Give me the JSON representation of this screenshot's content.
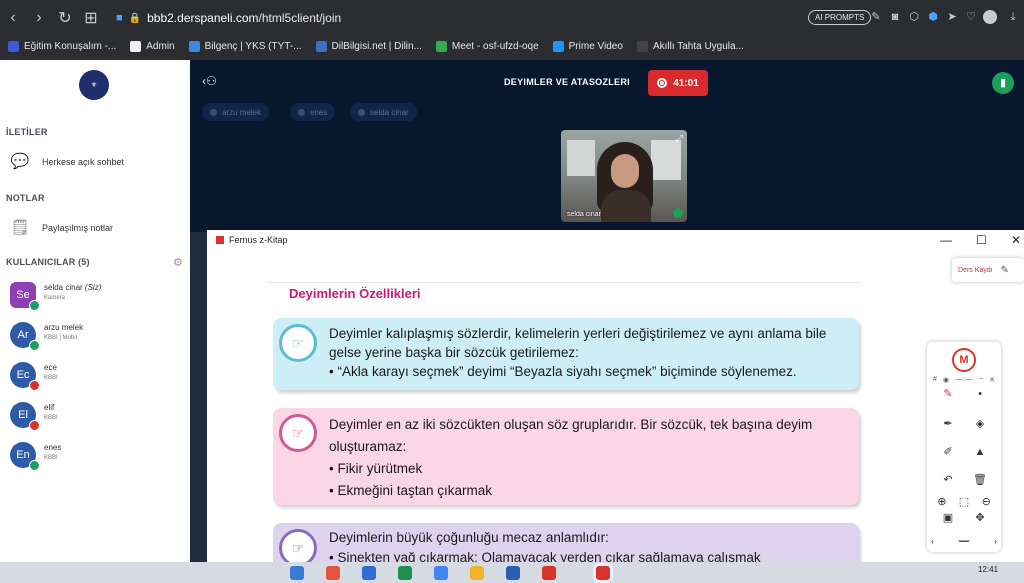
{
  "browser": {
    "url_host": "bbb2.derspaneli.com",
    "url_path": "/html5client/join",
    "ai_prompts": "AI PROMPTS",
    "bookmarks": [
      {
        "label": "Eğitim Konuşalım -...",
        "color": "#3b5bd8"
      },
      {
        "label": "Admin",
        "color": "#f0f0f0"
      },
      {
        "label": "Bilgenç | YKS (TYT-...",
        "color": "#3a8be0"
      },
      {
        "label": "DilBilgisi.net | Dilin...",
        "color": "#3a70c0"
      },
      {
        "label": "Meet - osf-ufzd-oqe",
        "color": "#34a853"
      },
      {
        "label": "Prime Video",
        "color": "#1a98ff"
      },
      {
        "label": "Akıllı Tahta Uygula...",
        "color": "#444444"
      }
    ]
  },
  "sidebar": {
    "messages_title": "İLETİLER",
    "public_chat": "Herkese açık sohbet",
    "notes_title": "NOTLAR",
    "shared_notes": "Paylaşılmış notlar",
    "users_title": "KULLANICILAR (5)",
    "users": [
      {
        "initials": "Se",
        "name": "selda cinar",
        "you": "(Siz)",
        "sub": "Kamera",
        "color": "#8e3fb8",
        "badge": "#1aa05a"
      },
      {
        "initials": "Ar",
        "name": "arzu melek",
        "you": "",
        "sub": "KBBI | Mobil",
        "color": "#2e5aa8",
        "badge": "#1aa05a"
      },
      {
        "initials": "Ec",
        "name": "ece",
        "you": "",
        "sub": "KBBI",
        "color": "#2e5aa8",
        "badge": "#d9342b"
      },
      {
        "initials": "El",
        "name": "elif",
        "you": "",
        "sub": "KBBI",
        "color": "#2e5aa8",
        "badge": "#d9342b"
      },
      {
        "initials": "En",
        "name": "enes",
        "you": "",
        "sub": "KBBI",
        "color": "#2e5aa8",
        "badge": "#1aa05a"
      }
    ]
  },
  "meeting": {
    "title": "DEYIMLER VE ATASOZLERI",
    "timer": "41:01",
    "talkers": [
      "arzu melek",
      "enes",
      "selda cinar"
    ],
    "video_name": "selda cinar"
  },
  "fernus": {
    "window_title": "Fernus z-Kitap",
    "ders_kaydi": "Ders Kaydı",
    "heading": "Deyimlerin Özellikleri",
    "card1": {
      "text": "Deyimler kalıplaşmış sözlerdir, kelimelerin yerleri değiştirilemez ve aynı anlama bile gelse yerine başka bir sözcük getirilemez:",
      "bullets": [
        "“Akla karayı seçmek” deyimi “Beyazla siyahı seçmek” biçiminde söylenemez."
      ]
    },
    "card2": {
      "text": "Deyimler en az iki sözcükten oluşan söz gruplarıdır. Bir sözcük, tek başına deyim oluşturamaz:",
      "bullets": [
        "Fikir yürütmek",
        "Ekmeğini taştan çıkarmak"
      ]
    },
    "card3": {
      "text": "Deyimlerin büyük çoğunluğu mecaz anlamlıdır:",
      "bullets": [
        "Sinekten yağ çıkarmak: Olamayacak yerden çıkar sağlamaya çalışmak"
      ]
    }
  },
  "taskbar": {
    "clock": "12:41"
  }
}
